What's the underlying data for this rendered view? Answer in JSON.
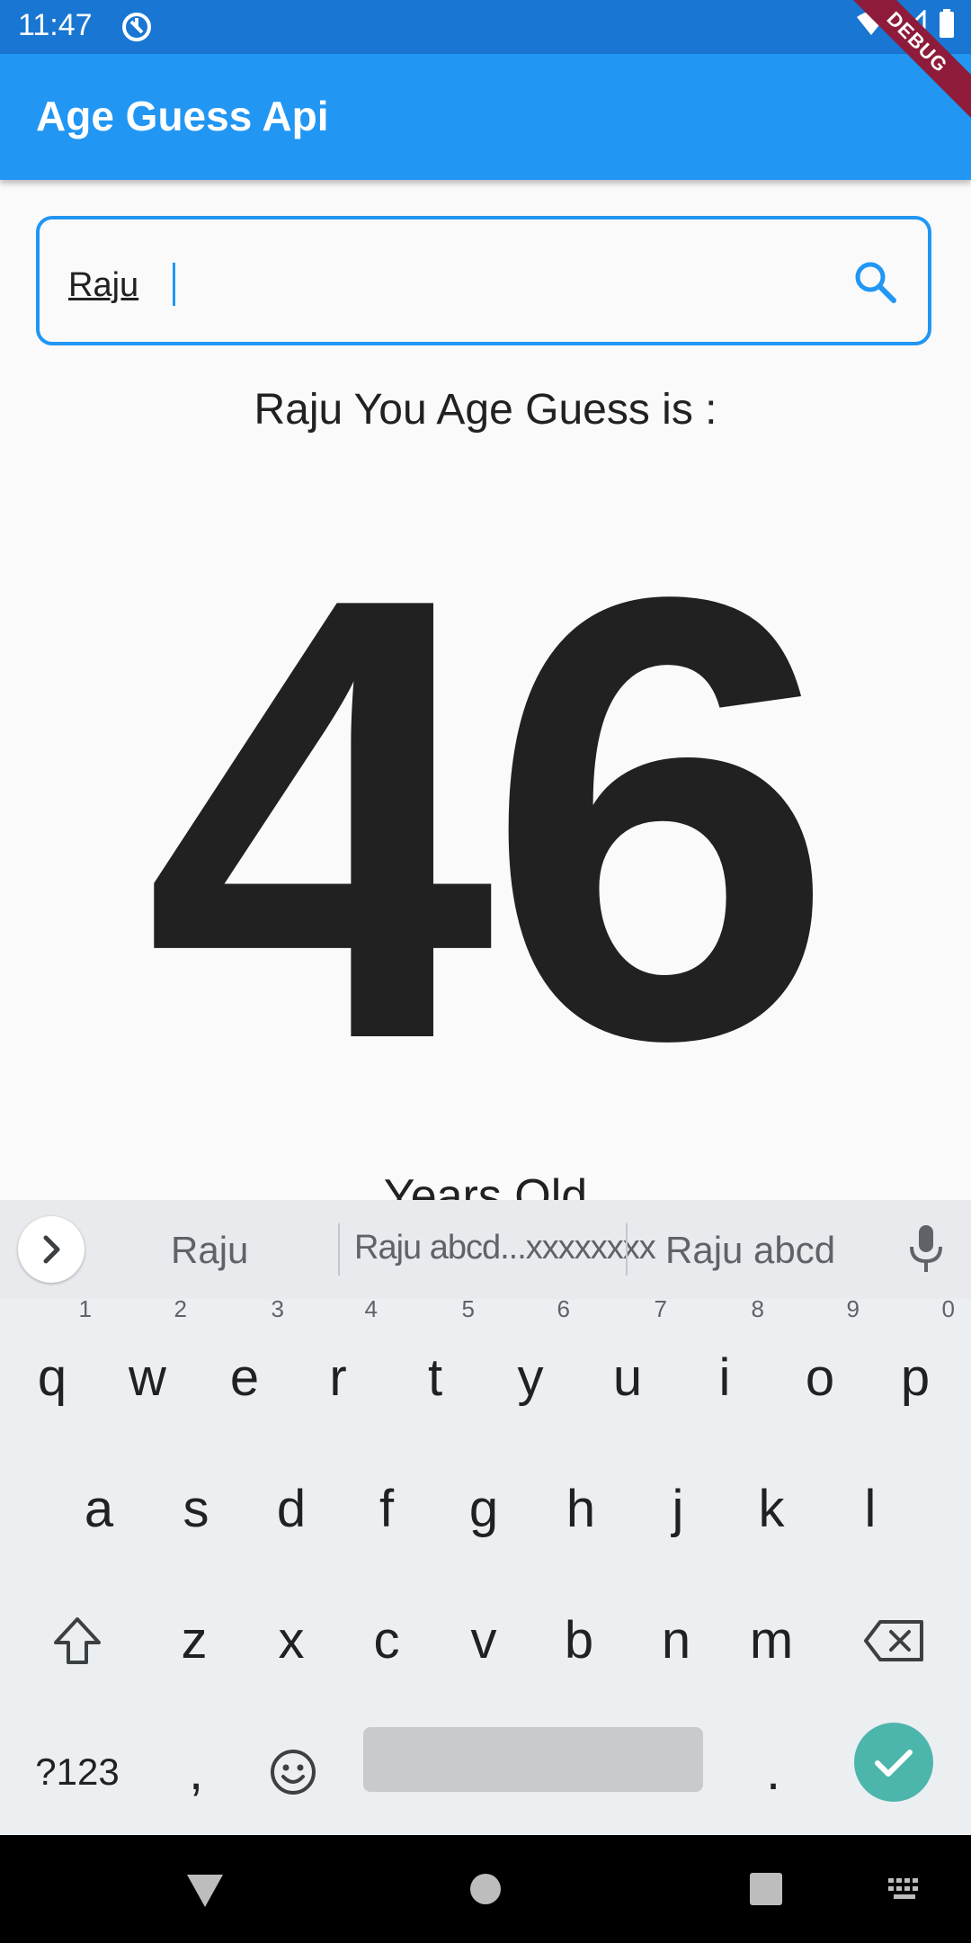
{
  "status_bar": {
    "time": "11:47"
  },
  "debug_banner": "DEBUG",
  "app_bar": {
    "title": "Age Guess Api"
  },
  "search": {
    "value": "Raju"
  },
  "result": {
    "label": "Raju You Age Guess is :",
    "age": "46",
    "unit": "Years Old"
  },
  "keyboard": {
    "suggestions": [
      "Raju",
      "Raju abcd...xxxxxxxx",
      "Raju abcd"
    ],
    "row1": [
      "q",
      "w",
      "e",
      "r",
      "t",
      "y",
      "u",
      "i",
      "o",
      "p"
    ],
    "row1_hints": [
      "1",
      "2",
      "3",
      "4",
      "5",
      "6",
      "7",
      "8",
      "9",
      "0"
    ],
    "row2": [
      "a",
      "s",
      "d",
      "f",
      "g",
      "h",
      "j",
      "k",
      "l"
    ],
    "row3": [
      "z",
      "x",
      "c",
      "v",
      "b",
      "n",
      "m"
    ],
    "symbols_key": "?123",
    "comma_key": ",",
    "period_key": "."
  },
  "colors": {
    "primary": "#2196f3",
    "status_bar": "#1976d2",
    "done_key": "#4db6ac"
  }
}
